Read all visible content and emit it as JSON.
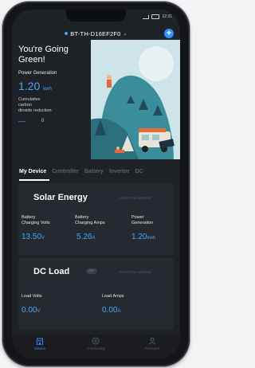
{
  "status_bar": {
    "time": "12:31"
  },
  "device": {
    "name": "BT-TH-D16EF2F0",
    "chevron": "⌄",
    "add_icon": "+"
  },
  "hero": {
    "title_line1": "You're Going",
    "title_line2": "Green!",
    "power_generation_label": "Power Generation",
    "power_generation_value": "1.20",
    "power_generation_unit": "kwh",
    "co2_label_line1": "Cumulative",
    "co2_label_line2": "carbon",
    "co2_label_line3": "dioxide reduction",
    "co2_value": "—",
    "co2_count": "0"
  },
  "tabs": [
    {
      "label": "My Device",
      "active": true
    },
    {
      "label": "Controller",
      "active": false
    },
    {
      "label": "Battery",
      "active": false
    },
    {
      "label": "Inverter",
      "active": false
    },
    {
      "label": "DC",
      "active": false
    }
  ],
  "solar": {
    "title": "Solar Energy",
    "mode": "PWO CTRL INVERSE",
    "metrics": [
      {
        "label_line1": "Battery",
        "label_line2": "Charging Volts",
        "value": "13.50",
        "unit": "V"
      },
      {
        "label_line1": "Battery",
        "label_line2": "Charging Amps",
        "value": "5.26",
        "unit": "A"
      },
      {
        "label_line1": "Power",
        "label_line2": "Generation",
        "value": "1.20",
        "unit": "kwh"
      }
    ]
  },
  "dc_load": {
    "title": "DC Load",
    "toggle": "OFF",
    "mode": "PWO CTRL INVERSE",
    "metrics": [
      {
        "label": "Load Volts",
        "value": "0.00",
        "unit": "V"
      },
      {
        "label": "Load Amps",
        "value": "0.00",
        "unit": "A"
      }
    ]
  },
  "bottom_nav": [
    {
      "label": "Device",
      "icon": "building-icon",
      "active": true
    },
    {
      "label": "Community",
      "icon": "community-icon",
      "active": false
    },
    {
      "label": "Personal",
      "icon": "person-icon",
      "active": false
    }
  ],
  "colors": {
    "accent": "#42a8ff",
    "background": "#1e2126",
    "card": "#262a30",
    "nav_active": "#2f8fff"
  }
}
